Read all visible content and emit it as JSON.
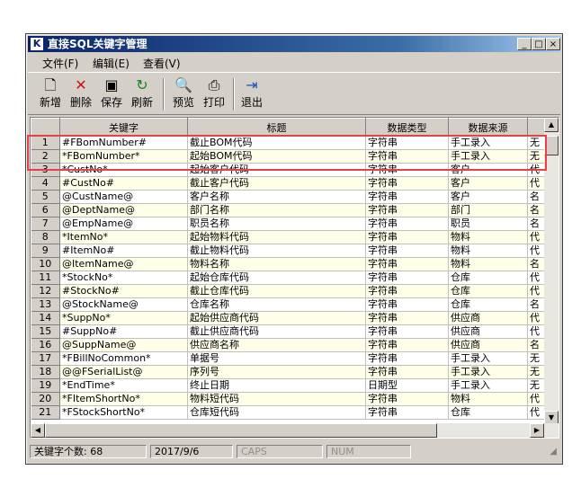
{
  "window": {
    "title": "直接SQL关键字管理",
    "icon": "app-icon",
    "buttons": [
      "_",
      "□",
      "×"
    ]
  },
  "menu": [
    "文件(F)",
    "编辑(E)",
    "查看(V)"
  ],
  "toolbar": [
    {
      "label": "新增",
      "icon": "new-file-icon"
    },
    {
      "label": "删除",
      "icon": "delete-x-icon"
    },
    {
      "label": "保存",
      "icon": "save-disk-icon"
    },
    {
      "label": "刷新",
      "icon": "refresh-icon"
    },
    {
      "label": "预览",
      "icon": "preview-icon"
    },
    {
      "label": "打印",
      "icon": "printer-icon"
    },
    {
      "label": "退出",
      "icon": "exit-door-icon"
    }
  ],
  "grid": {
    "columns": [
      "",
      "关键字",
      "标题",
      "数据类型",
      "数据来源",
      ""
    ],
    "rows": [
      [
        "1",
        "#FBomNumber#",
        "截止BOM代码",
        "字符串",
        "手工录入",
        "无"
      ],
      [
        "2",
        "*FBomNumber*",
        "起始BOM代码",
        "字符串",
        "手工录入",
        "无"
      ],
      [
        "3",
        "*CustNo*",
        "起始客户代码",
        "字符串",
        "客户",
        "代"
      ],
      [
        "4",
        "#CustNo#",
        "截止客户代码",
        "字符串",
        "客户",
        "代"
      ],
      [
        "5",
        "@CustName@",
        "客户名称",
        "字符串",
        "客户",
        "名"
      ],
      [
        "6",
        "@DeptName@",
        "部门名称",
        "字符串",
        "部门",
        "名"
      ],
      [
        "7",
        "@EmpName@",
        "职员名称",
        "字符串",
        "职员",
        "名"
      ],
      [
        "8",
        "*ItemNo*",
        "起始物料代码",
        "字符串",
        "物料",
        "代"
      ],
      [
        "9",
        "#ItemNo#",
        "截止物料代码",
        "字符串",
        "物料",
        "代"
      ],
      [
        "10",
        "@ItemName@",
        "物料名称",
        "字符串",
        "物料",
        "名"
      ],
      [
        "11",
        "*StockNo*",
        "起始仓库代码",
        "字符串",
        "仓库",
        "代"
      ],
      [
        "12",
        "#StockNo#",
        "截止仓库代码",
        "字符串",
        "仓库",
        "代"
      ],
      [
        "13",
        "@StockName@",
        "仓库名称",
        "字符串",
        "仓库",
        "名"
      ],
      [
        "14",
        "*SuppNo*",
        "起始供应商代码",
        "字符串",
        "供应商",
        "代"
      ],
      [
        "15",
        "#SuppNo#",
        "截止供应商代码",
        "字符串",
        "供应商",
        "代"
      ],
      [
        "16",
        "@SuppName@",
        "供应商名称",
        "字符串",
        "供应商",
        "名"
      ],
      [
        "17",
        "*FBillNoCommon*",
        "单据号",
        "字符串",
        "手工录入",
        "无"
      ],
      [
        "18",
        "@@FSerialList@",
        "序列号",
        "字符串",
        "手工录入",
        "无"
      ],
      [
        "19",
        "*EndTime*",
        "终止日期",
        "日期型",
        "手工录入",
        "无"
      ],
      [
        "20",
        "*FItemShortNo*",
        "物料短代码",
        "字符串",
        "物料",
        "代"
      ],
      [
        "21",
        "*FStockShortNo*",
        "仓库短代码",
        "字符串",
        "仓库",
        "代"
      ]
    ]
  },
  "status": [
    "关键字个数: 68",
    "2017/9/6",
    "CAPS",
    "NUM"
  ]
}
